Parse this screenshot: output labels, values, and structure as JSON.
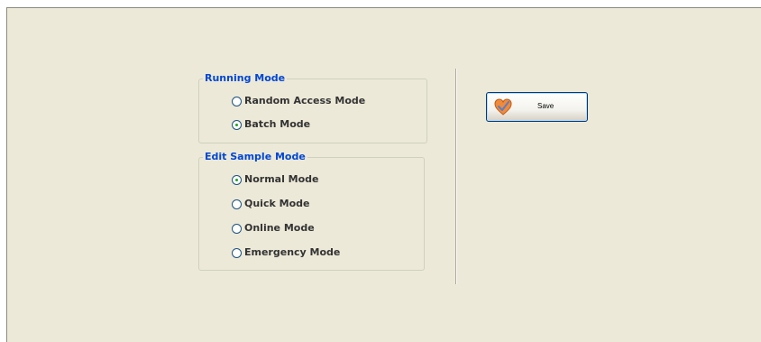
{
  "running_mode": {
    "title": "Running Mode",
    "options": [
      {
        "label": "Random Access Mode",
        "checked": false
      },
      {
        "label": "Batch Mode",
        "checked": true
      }
    ]
  },
  "edit_sample_mode": {
    "title": "Edit Sample Mode",
    "options": [
      {
        "label": "Normal Mode",
        "checked": true
      },
      {
        "label": "Quick Mode",
        "checked": false
      },
      {
        "label": "Online Mode",
        "checked": false
      },
      {
        "label": "Emergency Mode",
        "checked": false
      }
    ]
  },
  "save_button": {
    "label": "Save",
    "icon": "heart-check-icon"
  },
  "colors": {
    "background": "#ece9d8",
    "group_title": "#0046d5",
    "radio_selected": "#21a121",
    "button_border": "#003c74",
    "icon_fill": "#f08a3c"
  }
}
